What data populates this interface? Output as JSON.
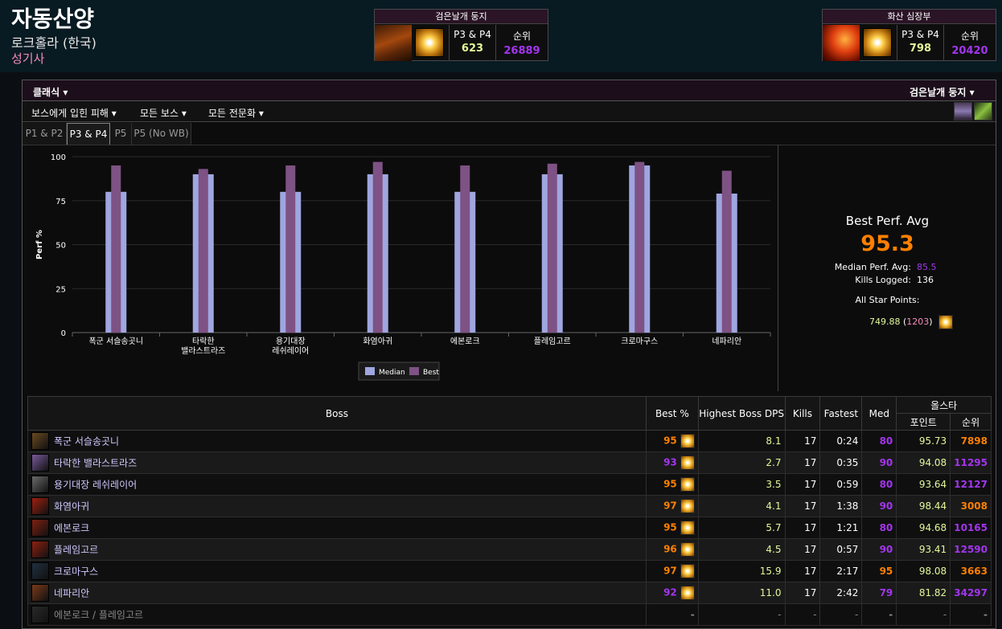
{
  "character": {
    "name": "자동산양",
    "realm": "로크홀라 (한국)",
    "spec": "성기사"
  },
  "colors": {
    "orange": "#ff8000",
    "purple": "#a335ee",
    "green": "#e2f79a",
    "pink": "#f58cba",
    "median_bar": "#9fa6e0",
    "best_bar": "#7e5284"
  },
  "rankboxes": [
    {
      "title": "검은날개 둥지",
      "label": "P3 & P4",
      "value": "623",
      "rank_label": "순위",
      "rank": "26889"
    },
    {
      "title": "화산 심장부",
      "label": "P3 & P4",
      "value": "798",
      "rank_label": "순위",
      "rank": "20420"
    }
  ],
  "toolbar": {
    "classic": "클래식",
    "zone": "검은날개 둥지",
    "damage": "보스에게 입힌 피해",
    "bosses": "모든 보스",
    "spec": "모든 전문화"
  },
  "tabs": [
    "P1 & P2",
    "P3 & P4",
    "P5",
    "P5 (No WB)"
  ],
  "summary": {
    "title": "Best Perf. Avg",
    "value": "95.3",
    "median_label": "Median Perf. Avg:",
    "median_value": "85.5",
    "kills_label": "Kills Logged:",
    "kills_value": "136",
    "allstar_label": "All Star Points:",
    "allstar_points": "749.88",
    "allstar_rank": "1203"
  },
  "chart_data": {
    "type": "bar",
    "categories": [
      "폭군 서슬송곳니",
      "타락한 밸라스트라즈",
      "용기대장 레쉬레이어",
      "화염아귀",
      "에본로크",
      "플레임고르",
      "크로마구스",
      "네파리안"
    ],
    "category_lines": [
      [
        "폭군 서슬송곳니"
      ],
      [
        "타락한",
        "밸라스트라즈"
      ],
      [
        "용기대장",
        "레쉬레이어"
      ],
      [
        "화염아귀"
      ],
      [
        "에본로크"
      ],
      [
        "플레임고르"
      ],
      [
        "크로마구스"
      ],
      [
        "네파리안"
      ]
    ],
    "series": [
      {
        "name": "Median",
        "values": [
          80,
          90,
          80,
          90,
          80,
          90,
          95,
          79
        ]
      },
      {
        "name": "Best",
        "values": [
          95,
          93,
          95,
          97,
          95,
          96,
          97,
          92
        ]
      }
    ],
    "ylabel": "Perf %",
    "ylim": [
      0,
      100
    ],
    "yticks": [
      0,
      25,
      50,
      75,
      100
    ],
    "grid": true,
    "legend": "bottom"
  },
  "table": {
    "headers": {
      "boss": "Boss",
      "best": "Best %",
      "hdps": "Highest Boss DPS",
      "kills": "Kills",
      "fastest": "Fastest",
      "med": "Med",
      "allstar": "올스타",
      "points": "포인트",
      "rank": "순위"
    },
    "rows": [
      {
        "boss": "폭군 서슬송곳니",
        "best": "95",
        "dps": "8.1",
        "kills": "17",
        "fastest": "0:24",
        "med": "80",
        "points": "95.73",
        "rank": "7898"
      },
      {
        "boss": "타락한 밸라스트라즈",
        "best": "93",
        "dps": "2.7",
        "kills": "17",
        "fastest": "0:35",
        "med": "90",
        "points": "94.08",
        "rank": "11295"
      },
      {
        "boss": "용기대장 레쉬레이어",
        "best": "95",
        "dps": "3.5",
        "kills": "17",
        "fastest": "0:59",
        "med": "80",
        "points": "93.64",
        "rank": "12127"
      },
      {
        "boss": "화염아귀",
        "best": "97",
        "dps": "4.1",
        "kills": "17",
        "fastest": "1:38",
        "med": "90",
        "points": "98.44",
        "rank": "3008"
      },
      {
        "boss": "에본로크",
        "best": "95",
        "dps": "5.7",
        "kills": "17",
        "fastest": "1:21",
        "med": "80",
        "points": "94.68",
        "rank": "10165"
      },
      {
        "boss": "플레임고르",
        "best": "96",
        "dps": "4.5",
        "kills": "17",
        "fastest": "0:57",
        "med": "90",
        "points": "93.41",
        "rank": "12590"
      },
      {
        "boss": "크로마구스",
        "best": "97",
        "dps": "15.9",
        "kills": "17",
        "fastest": "2:17",
        "med": "95",
        "points": "98.08",
        "rank": "3663"
      },
      {
        "boss": "네파리안",
        "best": "92",
        "dps": "11.0",
        "kills": "17",
        "fastest": "2:42",
        "med": "79",
        "points": "81.82",
        "rank": "34297"
      },
      {
        "boss": "에본로크 / 플레임고르",
        "best": "-",
        "dps": "-",
        "kills": "-",
        "fastest": "-",
        "med": "-",
        "points": "-",
        "rank": "-"
      }
    ]
  }
}
